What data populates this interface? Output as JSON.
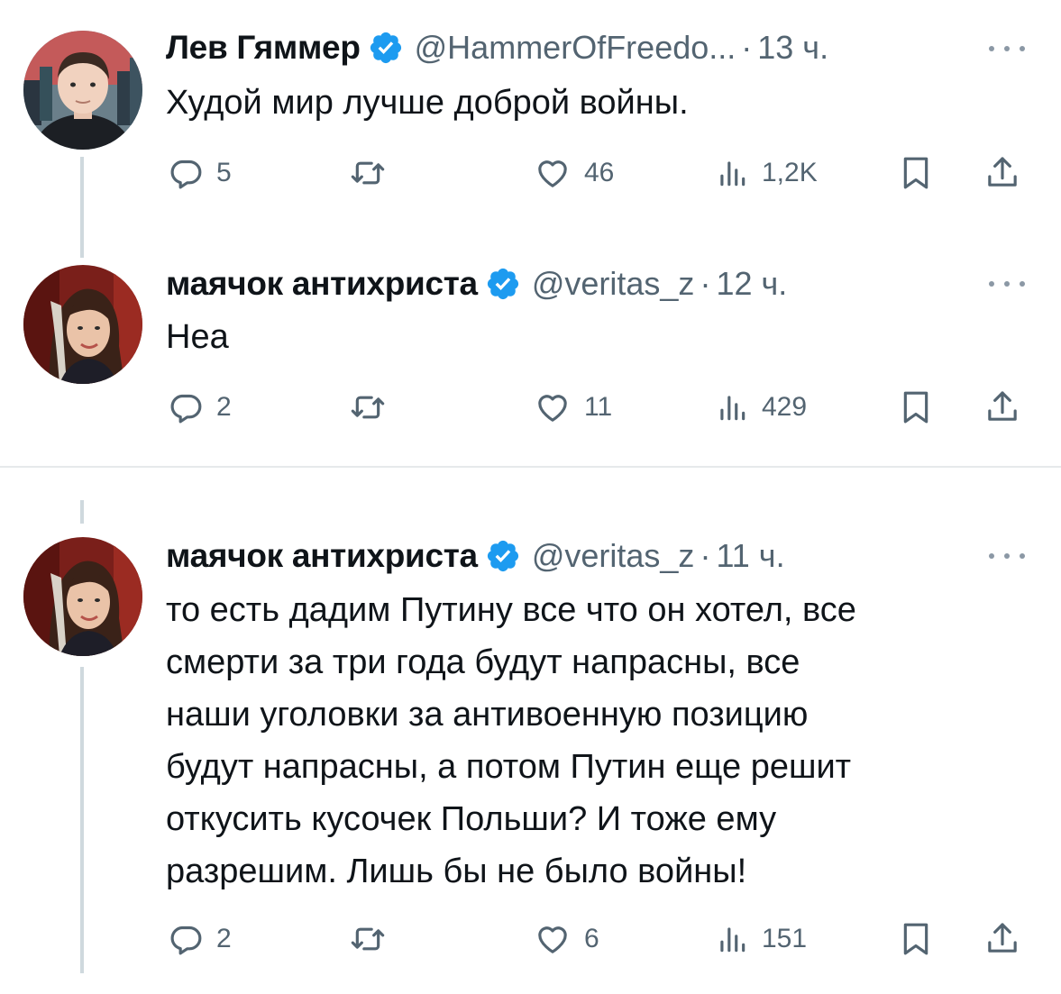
{
  "colors": {
    "verified_badge": "#1d9bf0",
    "secondary_text": "#536471",
    "thread_line": "#cfd9de"
  },
  "tweets": [
    {
      "author_name": "Лев Гяммер",
      "handle": "@HammerOfFreedo...",
      "separator": "·",
      "time": "13 ч.",
      "text": "Худой мир лучше доброй войны.",
      "avatar": "avatar-young-man",
      "replies": "5",
      "retweets": "",
      "likes": "46",
      "views": "1,2K"
    },
    {
      "author_name": "маячок антихриста",
      "handle": "@veritas_z",
      "separator": "·",
      "time": "12 ч.",
      "text": "Неа",
      "avatar": "avatar-woman",
      "replies": "2",
      "retweets": "",
      "likes": "11",
      "views": "429"
    },
    {
      "author_name": "маячок антихриста",
      "handle": "@veritas_z",
      "separator": "·",
      "time": "11 ч.",
      "text_lines": [
        "то есть дадим Путину все что он хотел, все",
        "смерти за три года будут напрасны, все",
        "наши уголовки за антивоенную позицию",
        "будут напрасны, а потом Путин еще решит",
        "откусить кусочек Польши? И тоже ему",
        "разрешим. Лишь бы не было войны!"
      ],
      "avatar": "avatar-woman",
      "replies": "2",
      "retweets": "",
      "likes": "6",
      "views": "151"
    }
  ],
  "icons": {
    "reply": "reply-icon",
    "retweet": "retweet-icon",
    "like": "like-icon",
    "views": "views-icon",
    "bookmark": "bookmark-icon",
    "share": "share-icon",
    "more": "more-icon",
    "verified": "verified-badge-icon"
  }
}
